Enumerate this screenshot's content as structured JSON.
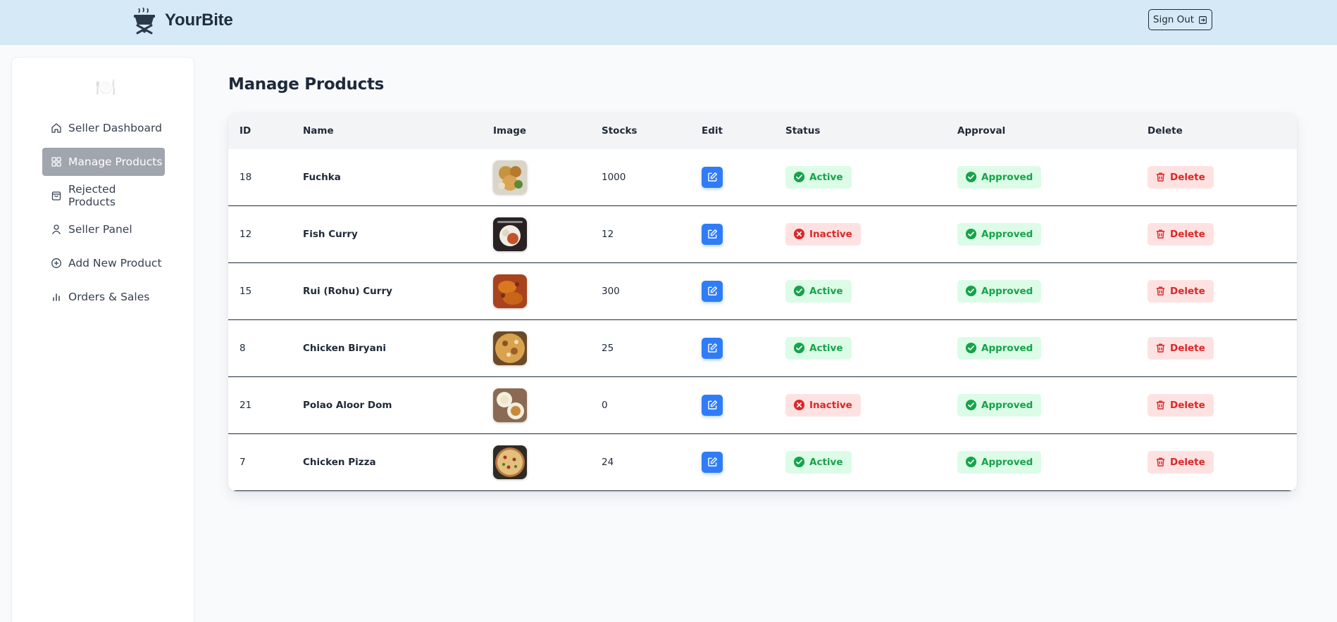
{
  "header": {
    "brand": "YourBite",
    "signout_label": "Sign Out"
  },
  "sidebar": {
    "emoji": "🍽️",
    "items": [
      {
        "label": "Seller Dashboard",
        "icon": "home-icon"
      },
      {
        "label": "Manage Products",
        "icon": "grid-icon",
        "active": true
      },
      {
        "label": "Rejected Products",
        "icon": "bag-icon"
      },
      {
        "label": "Seller Panel",
        "icon": "user-icon"
      },
      {
        "label": "Add New Product",
        "icon": "plus-circle-icon"
      },
      {
        "label": "Orders & Sales",
        "icon": "bar-chart-icon"
      }
    ]
  },
  "page": {
    "title": "Manage Products"
  },
  "table": {
    "columns": [
      "ID",
      "Name",
      "Image",
      "Stocks",
      "Edit",
      "Status",
      "Approval",
      "Delete"
    ],
    "delete_label": "Delete",
    "rows": [
      {
        "id": "18",
        "name": "Fuchka",
        "stocks": "1000",
        "status": "Active",
        "approval": "Approved"
      },
      {
        "id": "12",
        "name": "Fish Curry",
        "stocks": "12",
        "status": "Inactive",
        "approval": "Approved"
      },
      {
        "id": "15",
        "name": "Rui (Rohu) Curry",
        "stocks": "300",
        "status": "Active",
        "approval": "Approved"
      },
      {
        "id": "8",
        "name": "Chicken Biryani",
        "stocks": "25",
        "status": "Active",
        "approval": "Approved"
      },
      {
        "id": "21",
        "name": "Polao Aloor Dom",
        "stocks": "0",
        "status": "Inactive",
        "approval": "Approved"
      },
      {
        "id": "7",
        "name": "Chicken Pizza",
        "stocks": "24",
        "status": "Active",
        "approval": "Approved"
      }
    ]
  },
  "colors": {
    "header_bg": "#d6e9f6",
    "active_nav": "#a0a5ae",
    "edit_blue": "#2f7cf6",
    "green": "#16a34a",
    "red": "#dc2626"
  }
}
